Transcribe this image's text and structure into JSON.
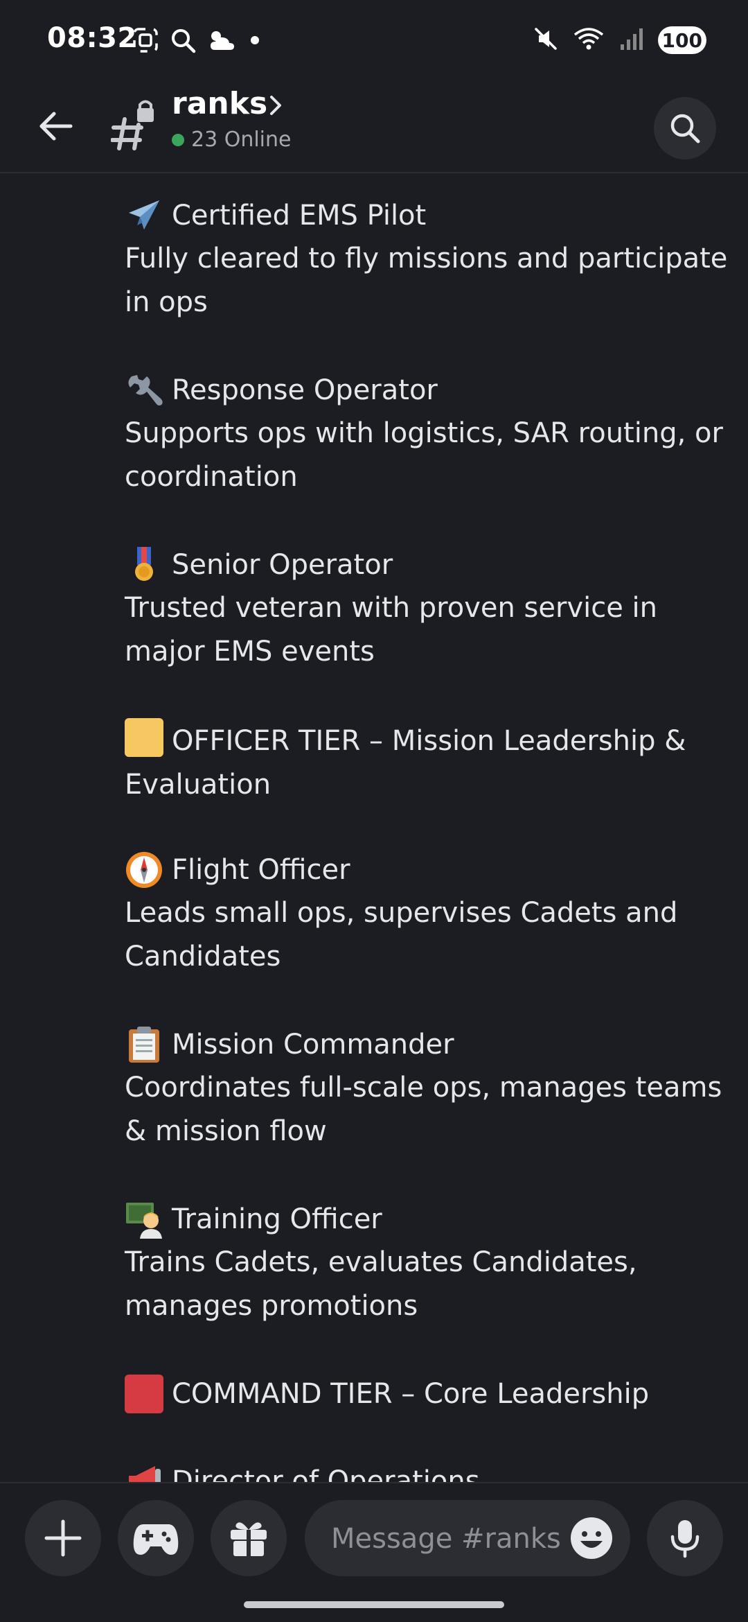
{
  "status_bar": {
    "time": "08:32",
    "battery": "100"
  },
  "header": {
    "channel_name": "ranks",
    "online_text": "23 Online"
  },
  "ranks": [
    {
      "emoji": "airplane-icon",
      "title": "Certified EMS Pilot",
      "description": "Fully cleared to fly missions and participate in ops"
    },
    {
      "emoji": "wrench-icon",
      "title": "Response Operator",
      "description": "Supports ops with logistics, SAR routing, or coordination"
    },
    {
      "emoji": "medal-icon",
      "title": "Senior Operator",
      "description": "Trusted veteran with proven service in major EMS events"
    },
    {
      "emoji": "yellow-square-icon",
      "title": "OFFICER TIER – Mission Leadership & Evaluation",
      "is_tier": true,
      "color": "#f5c862"
    },
    {
      "emoji": "compass-icon",
      "title": "Flight Officer",
      "description": "Leads small ops, supervises Cadets and Candidates"
    },
    {
      "emoji": "clipboard-icon",
      "title": "Mission Commander",
      "description": "Coordinates full-scale ops, manages teams & mission flow"
    },
    {
      "emoji": "teacher-icon",
      "title": "Training Officer",
      "description": "Trains Cadets, evaluates Candidates, manages promotions"
    },
    {
      "emoji": "red-square-icon",
      "title": "COMMAND TIER – Core Leadership",
      "is_tier": true,
      "color": "#d63b43"
    },
    {
      "emoji": "megaphone-icon",
      "title": "Director of Operations"
    }
  ],
  "composer": {
    "placeholder": "Message #ranks"
  },
  "colors": {
    "background": "#1c1d22",
    "surface": "#2b2d33",
    "online": "#3ba55c",
    "text": "#e6e7ea",
    "muted": "#a7a9b0"
  }
}
